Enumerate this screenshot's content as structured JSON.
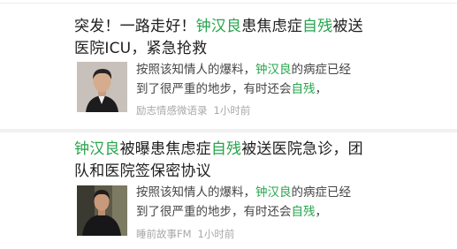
{
  "results": [
    {
      "title": [
        {
          "t": "突发！一路走好！"
        },
        {
          "t": "钟汉良",
          "hl": true
        },
        {
          "t": "患焦虑症"
        },
        {
          "t": "自残",
          "hl": true
        },
        {
          "t": "被送医院ICU，紧急抢救"
        }
      ],
      "snippet": [
        {
          "t": "按照该知情人的爆料，"
        },
        {
          "t": "钟汉良",
          "hl": true
        },
        {
          "t": "的病症已经到了很严重的地步，有时还会"
        },
        {
          "t": "自残",
          "hl": true
        },
        {
          "t": "，"
        }
      ],
      "source": "励志情感微语录",
      "time": "1小时前",
      "thumbnail": "portrait of man in suit"
    },
    {
      "title": [
        {
          "t": "钟汉良",
          "hl": true
        },
        {
          "t": "被曝患焦虑症"
        },
        {
          "t": "自残",
          "hl": true
        },
        {
          "t": "被送医院急诊，团队和医院签保密协议"
        }
      ],
      "snippet": [
        {
          "t": "按照该知情人的爆料，"
        },
        {
          "t": "钟汉良",
          "hl": true
        },
        {
          "t": "的病症已经到了很严重的地步，有时还会"
        },
        {
          "t": "自残",
          "hl": true
        },
        {
          "t": "，"
        }
      ],
      "source": "睡前故事FM",
      "time": "1小时前",
      "thumbnail": "man in dark jacket outdoors"
    }
  ],
  "colors": {
    "highlight": "#26a54b",
    "text": "#1e1e1e",
    "snippet": "#444444",
    "meta": "#a8a8a8"
  }
}
